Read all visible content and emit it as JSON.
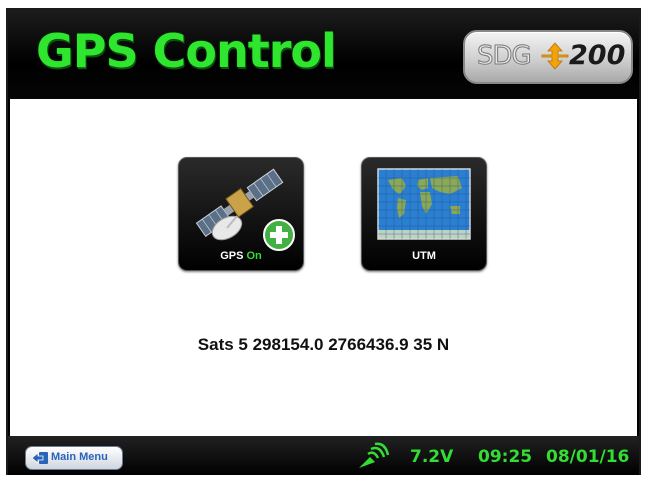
{
  "header": {
    "title": "GPS Control",
    "logo": {
      "brand": "SDG",
      "model": "200"
    }
  },
  "tiles": [
    {
      "label_prefix": "GPS ",
      "label_state": "On",
      "icon": "satellite-icon"
    },
    {
      "label": "UTM",
      "icon": "world-map-icon"
    }
  ],
  "status": {
    "text": "Sats 5 298154.0 2766436.9 35 N"
  },
  "footer": {
    "main_menu": "Main Menu",
    "voltage": "7.2V",
    "time": "09:25",
    "date": "08/01/16"
  },
  "colors": {
    "title_green": "#2ee62e",
    "status_green": "#33dd33",
    "logo_arrow": "#f2a20a",
    "map_ocean": "#2b7fd0",
    "map_land": "#8aa855"
  }
}
